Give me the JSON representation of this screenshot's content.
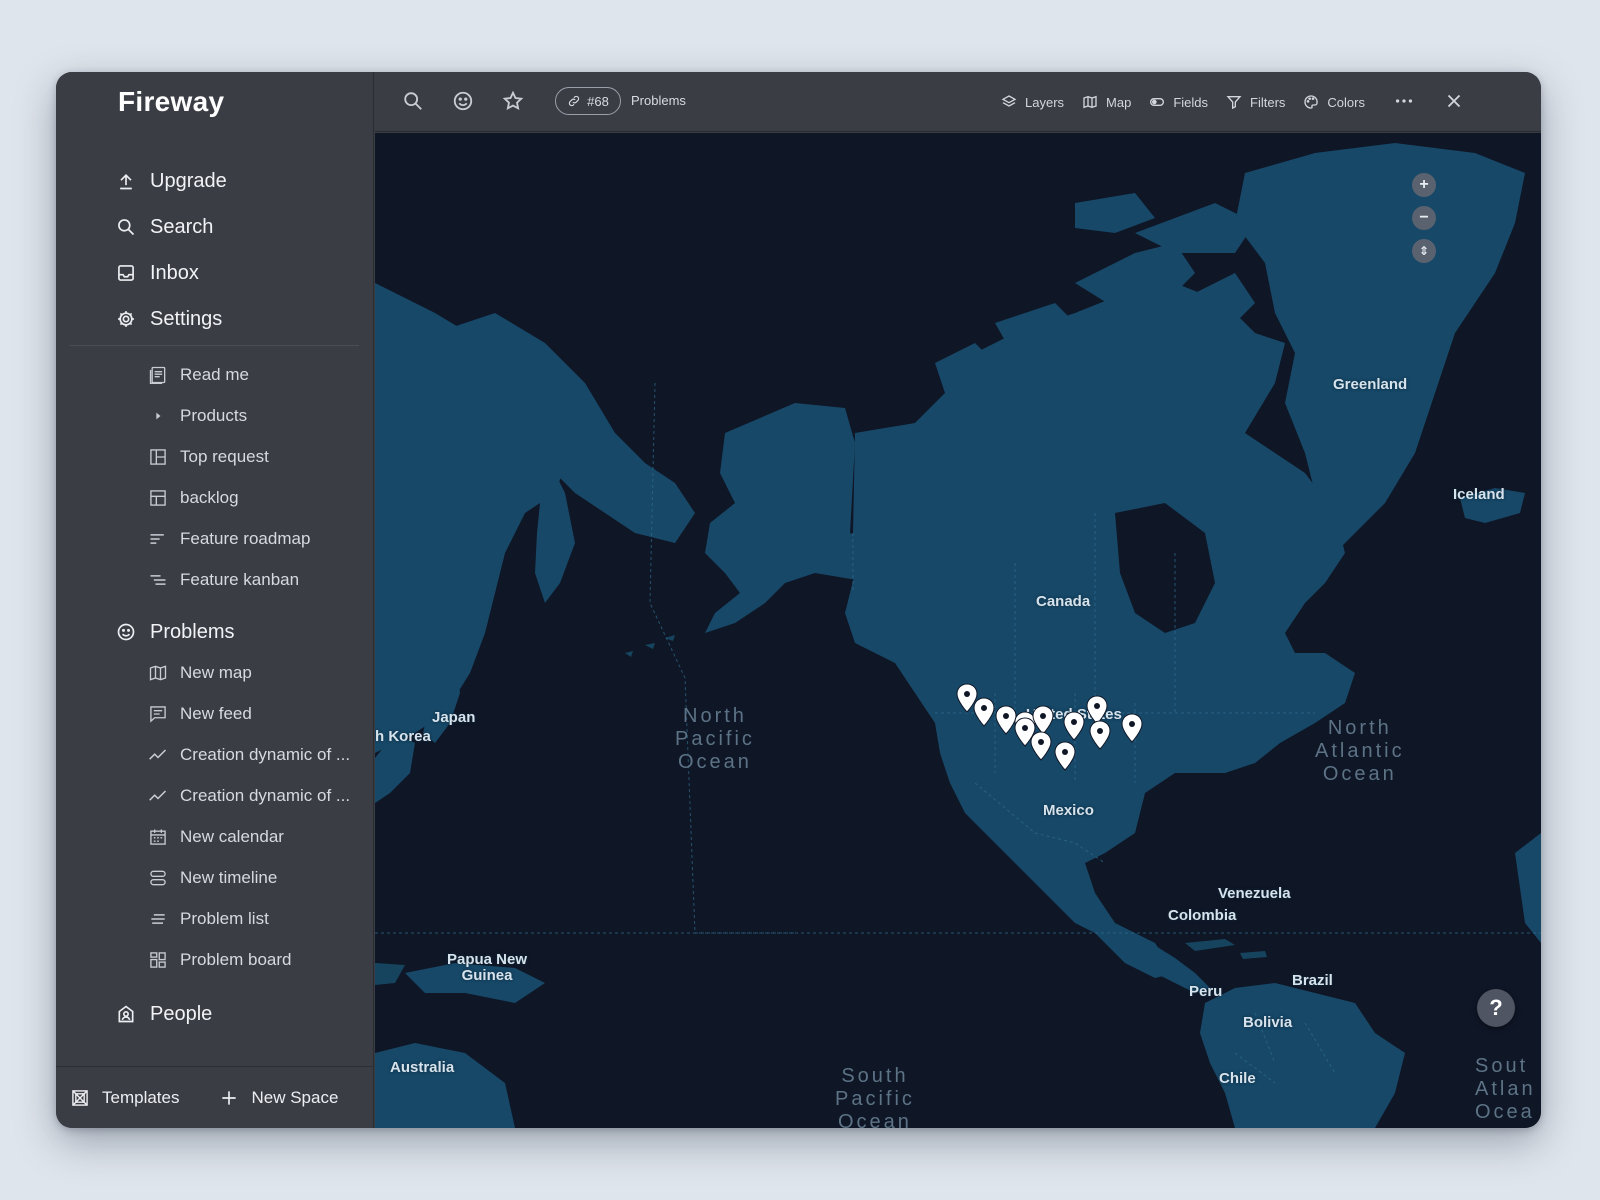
{
  "app": {
    "name": "Fireway"
  },
  "sidebar": {
    "main": [
      {
        "label": "Upgrade",
        "icon": "upload-icon"
      },
      {
        "label": "Search",
        "icon": "search-icon"
      },
      {
        "label": "Inbox",
        "icon": "inbox-icon"
      },
      {
        "label": "Settings",
        "icon": "gear-icon"
      }
    ],
    "docs": [
      {
        "label": "Read me",
        "icon": "document-icon"
      },
      {
        "label": "Products",
        "icon": "caret-right-icon"
      },
      {
        "label": "Top request",
        "icon": "table-icon"
      },
      {
        "label": "backlog",
        "icon": "table-icon"
      },
      {
        "label": "Feature roadmap",
        "icon": "roadmap-icon"
      },
      {
        "label": "Feature kanban",
        "icon": "kanban-icon"
      }
    ],
    "problems_section": {
      "label": "Problems",
      "icon": "smiley-icon"
    },
    "problems": [
      {
        "label": "New map",
        "icon": "map-icon"
      },
      {
        "label": "New feed",
        "icon": "feed-icon"
      },
      {
        "label": "Creation dynamic of ...",
        "icon": "chart-line-icon"
      },
      {
        "label": "Creation dynamic of ...",
        "icon": "chart-line-icon"
      },
      {
        "label": "New calendar",
        "icon": "calendar-icon"
      },
      {
        "label": "New timeline",
        "icon": "timeline-icon"
      },
      {
        "label": "Problem list",
        "icon": "list-icon"
      },
      {
        "label": "Problem board",
        "icon": "board-icon"
      }
    ],
    "people_section": {
      "label": "People",
      "icon": "people-icon"
    },
    "footer": {
      "templates": "Templates",
      "new_space": "New Space"
    }
  },
  "toolbar": {
    "chip_id": "#68",
    "breadcrumb": "Problems",
    "buttons": {
      "layers": "Layers",
      "map": "Map",
      "fields": "Fields",
      "filters": "Filters",
      "colors": "Colors"
    }
  },
  "map": {
    "labels": {
      "greenland": "Greenland",
      "iceland": "Iceland",
      "canada": "Canada",
      "united_states": "United States",
      "mexico": "Mexico",
      "japan": "Japan",
      "korea": "h Korea",
      "venezuela": "Venezuela",
      "colombia": "Colombia",
      "peru": "Peru",
      "brazil": "Brazil",
      "bolivia": "Bolivia",
      "chile": "Chile",
      "papua": "Papua New\nGuinea",
      "australia": "Australia"
    },
    "oceans": {
      "north_pacific": "North\nPacific\nOcean",
      "north_atlantic": "North\nAtlantic\nOcean",
      "south_pacific": "South\nPacific\nOcean",
      "south_atlantic": "Sout\nAtlan\nOcea"
    },
    "controls": {
      "zoom_in": "+",
      "zoom_out": "−",
      "compass": "⇕",
      "help": "?"
    },
    "pin_count": 12,
    "colors": {
      "water": "#0f1626",
      "land": "#174868",
      "pin": "#ffffff"
    }
  }
}
